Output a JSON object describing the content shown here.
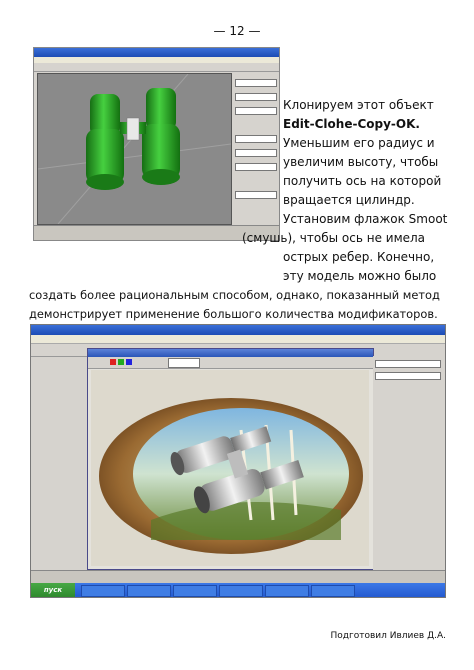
{
  "page": {
    "number": "— 12 —",
    "footer": "Подготовил Ивлиев Д.А."
  },
  "paragraph": {
    "line1": "Клонируем этот объект",
    "line2": "Edit-Clohe-Copy-OK.",
    "line3": "Уменьшим его радиус и",
    "line4": "увеличим высоту, чтобы",
    "line5": "получить ось на которой",
    "line6": "вращается цилиндр.",
    "line7": "Установим флажок Smoot",
    "line8": "(смушь), чтобы ось не имела",
    "line9": "острых ребер. Конечно,",
    "line10": "эту модель можно было",
    "line11": "создать более рациональным способом, однако, показанный метод",
    "line12": "демонстрирует применение большого количества модификаторов."
  },
  "screenshot2": {
    "start_label": "пуск"
  },
  "colors": {
    "model_green": "#2fa12c",
    "titlebar_blue": "#1d4cb4",
    "taskbar_blue": "#245ad0",
    "start_green": "#3b9a38"
  },
  "icons": {
    "model": "binoculars-model",
    "render": "binoculars-render"
  }
}
